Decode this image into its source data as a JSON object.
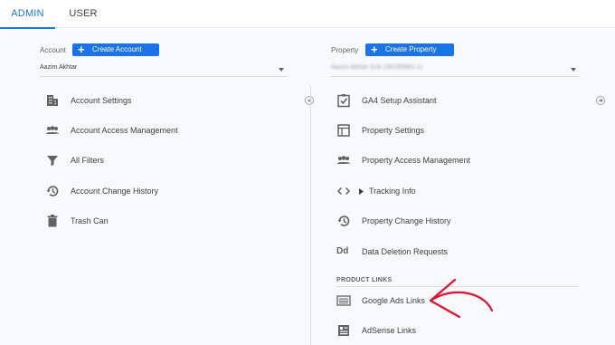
{
  "tabs": [
    {
      "label": "ADMIN",
      "active": true
    },
    {
      "label": "USER",
      "active": false
    }
  ],
  "account": {
    "label": "Account",
    "create_label": "Create Account",
    "selected": "Aazim Akhtar",
    "items": [
      {
        "label": "Account Settings",
        "icon": "building-icon"
      },
      {
        "label": "Account Access Management",
        "icon": "people-icon"
      },
      {
        "label": "All Filters",
        "icon": "filter-icon"
      },
      {
        "label": "Account Change History",
        "icon": "history-icon"
      },
      {
        "label": "Trash Can",
        "icon": "trash-icon"
      }
    ]
  },
  "property": {
    "label": "Property",
    "create_label": "Create Property",
    "selected": "Aazim Akhtar (UA-190185861-1)",
    "items": [
      {
        "label": "GA4 Setup Assistant",
        "icon": "checkbox-icon"
      },
      {
        "label": "Property Settings",
        "icon": "layout-icon"
      },
      {
        "label": "Property Access Management",
        "icon": "people-icon"
      },
      {
        "label": "Tracking Info",
        "icon": "code-icon"
      },
      {
        "label": "Property Change History",
        "icon": "history-icon"
      },
      {
        "label": "Data Deletion Requests",
        "icon": "dd-icon"
      }
    ],
    "section_header": "PRODUCT LINKS",
    "product_links": [
      {
        "label": "Google Ads Links",
        "icon": "ads-icon"
      },
      {
        "label": "AdSense Links",
        "icon": "adsense-icon"
      }
    ],
    "dd_glyph": "Dd"
  },
  "colors": {
    "accent": "#1a73e8",
    "annotation": "#e8102a",
    "icon": "#5f6368"
  }
}
